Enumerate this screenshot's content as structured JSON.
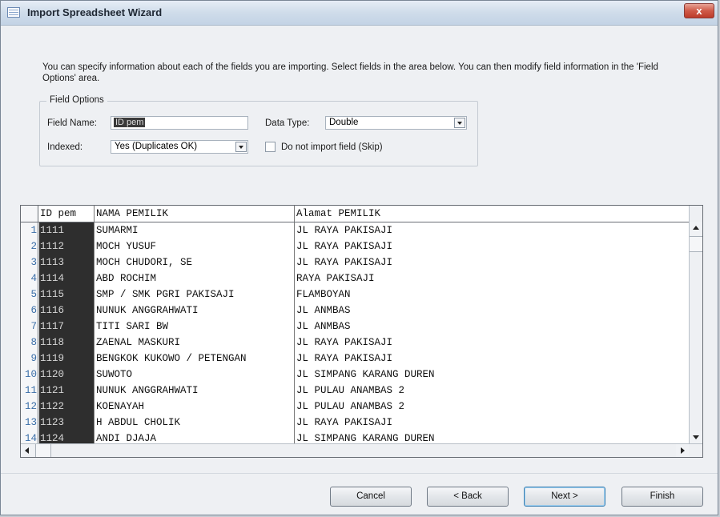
{
  "window": {
    "title": "Import Spreadsheet Wizard",
    "close_label": "x"
  },
  "intro": "You can specify information about each of the fields you are importing.  Select fields in the area below. You can then modify field information in the 'Field Options' area.",
  "field_options": {
    "legend": "Field Options",
    "field_name_label": "Field Name:",
    "field_name_value": "ID pem",
    "data_type_label": "Data Type:",
    "data_type_value": "Double",
    "indexed_label": "Indexed:",
    "indexed_value": "Yes (Duplicates OK)",
    "skip_label": "Do not import field (Skip)",
    "skip_checked": false
  },
  "grid": {
    "headers": [
      "ID pem",
      "NAMA PEMILIK",
      "Alamat PEMILIK"
    ],
    "rows": [
      [
        "1",
        "1111",
        "SUMARMI",
        "JL RAYA PAKISAJI"
      ],
      [
        "2",
        "1112",
        "MOCH YUSUF",
        "JL RAYA PAKISAJI"
      ],
      [
        "3",
        "1113",
        "MOCH CHUDORI, SE",
        "JL RAYA PAKISAJI"
      ],
      [
        "4",
        "1114",
        "ABD ROCHIM",
        "RAYA PAKISAJI"
      ],
      [
        "5",
        "1115",
        "SMP / SMK PGRI PAKISAJI",
        "FLAMBOYAN"
      ],
      [
        "6",
        "1116",
        "NUNUK ANGGRAHWATI",
        "JL ANMBAS"
      ],
      [
        "7",
        "1117",
        "TITI SARI BW",
        "JL ANMBAS"
      ],
      [
        "8",
        "1118",
        "ZAENAL MASKURI",
        "JL RAYA PAKISAJI"
      ],
      [
        "9",
        "1119",
        "BENGKOK KUKOWO / PETENGAN",
        "JL RAYA PAKISAJI"
      ],
      [
        "10",
        "1120",
        "SUWOTO",
        "JL SIMPANG KARANG DUREN"
      ],
      [
        "11",
        "1121",
        "NUNUK ANGGRAHWATI",
        "JL PULAU ANAMBAS 2"
      ],
      [
        "12",
        "1122",
        "KOENAYAH",
        "JL PULAU ANAMBAS 2"
      ],
      [
        "13",
        "1123",
        "H ABDUL CHOLIK",
        "JL RAYA PAKISAJI"
      ],
      [
        "14",
        "1124",
        "ANDI DJAJA",
        "JL SIMPANG KARANG DUREN"
      ]
    ]
  },
  "buttons": {
    "cancel": "Cancel",
    "back": "< Back",
    "next": "Next >",
    "finish": "Finish"
  }
}
